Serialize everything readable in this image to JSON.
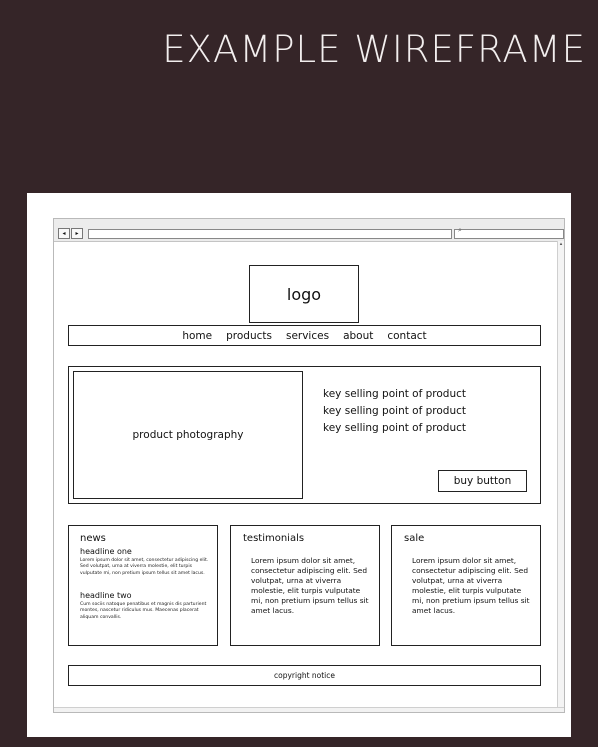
{
  "page_title": "EXAMPLE WIREFRAME",
  "browser": {
    "back_glyph": "◂",
    "forward_glyph": "▸",
    "search_glyph": "⌕",
    "scroll_up_glyph": "▴",
    "scroll_down_glyph": "▾"
  },
  "logo": "logo",
  "nav": [
    "home",
    "products",
    "services",
    "about",
    "contact"
  ],
  "hero": {
    "photo_label": "product photography",
    "points": [
      "key selling point of product",
      "key selling point of product",
      "key selling point of product"
    ],
    "buy_button": "buy button"
  },
  "news": {
    "title": "news",
    "headline_one": "headline one",
    "text_one": "Lorem ipsum dolor sit amet, consectetur adipiscing elit. Sed volutpat, urna at viverra molestie, elit turpis vulputate mi, non pretium ipsum tellus sit amet lacus.",
    "headline_two": "headline two",
    "text_two": "Cum sociis natoque penatibus et magnis dis parturient montes, nascetur ridiculus mus. Maecenas placerat aliquam convallis."
  },
  "testimonials": {
    "title": "testimonials",
    "text": "Lorem ipsum dolor sit amet, consectetur adipiscing elit. Sed volutpat, urna at viverra molestie, elit turpis vulputate mi, non pretium ipsum tellus sit amet lacus."
  },
  "sale": {
    "title": "sale",
    "text": "Lorem ipsum dolor sit amet, consectetur adipiscing elit. Sed volutpat, urna at viverra molestie, elit turpis vulputate mi, non pretium ipsum tellus sit amet lacus."
  },
  "footer": "copyright notice"
}
